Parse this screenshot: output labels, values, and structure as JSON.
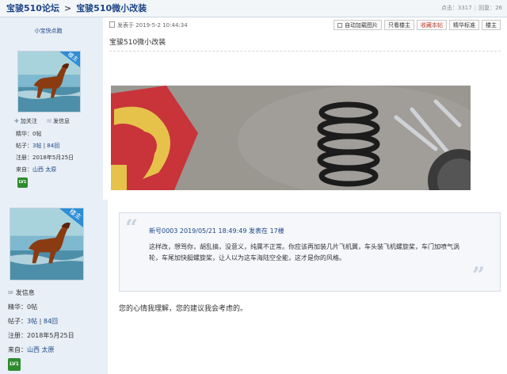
{
  "header": {
    "forum": "宝骏510论坛",
    "separator": ">",
    "thread_title": "宝骏510微小改装",
    "views_label": "点击：",
    "views": "3317",
    "replies_label": "回复：",
    "replies": "26"
  },
  "user1": {
    "name": "小宝快点跑",
    "badge": "楼主",
    "follow": "加关注",
    "message": "发信息",
    "jinghua_label": "精华：",
    "jinghua": "0帖",
    "posts_label": "帖子：",
    "posts_a": "3帖",
    "posts_b": "84回",
    "register": "注册：2018年5月25日",
    "from_label": "来自：",
    "from": "山西 太原",
    "level": "LV1"
  },
  "post": {
    "posted": "发表于 2019-5-2 10:44:34",
    "title": "宝骏510微小改装",
    "toolbar": {
      "auto_load": "自动加载图片",
      "only_op": "只看楼主",
      "favorite": "收藏本帖",
      "elite": "精华标准",
      "floor": "楼主"
    }
  },
  "user2": {
    "badge": "楼主",
    "message": "发信息",
    "jinghua_label": "精华：",
    "jinghua": "0帖",
    "posts_label": "帖子：",
    "posts_a": "3帖",
    "posts_b": "84回",
    "register": "注册：2018年5月25日",
    "from_label": "来自：",
    "from": "山西 太原",
    "level": "LV1"
  },
  "quote": {
    "author": "新号0003",
    "time": "2019/05/21 18:49:49 发表在",
    "floor": "17楼",
    "body": "这样改，想骂你，胡乱搞，没意义，纯属不正常。你应该再加装几片飞机翼，车头装飞机螺旋桨，车门加喷气涡轮，车尾加快艇螺旋桨，让人以为这车海陆空全能，这才是你的风格。"
  },
  "reply": "您的心情我理解，您的建议我会考虑的。",
  "colors": {
    "link": "#1c4587",
    "left_bg": "#e8eff7",
    "badge": "#2d8dd6",
    "favorite": "#c0392b"
  }
}
